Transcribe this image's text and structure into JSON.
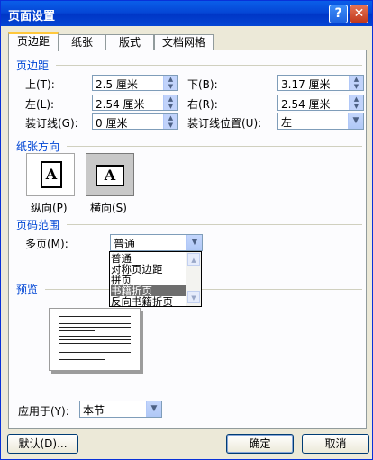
{
  "window": {
    "title": "页面设置",
    "help_glyph": "?",
    "close_glyph": "✕"
  },
  "tabs": [
    "页边距",
    "纸张",
    "版式",
    "文档网格"
  ],
  "margins": {
    "group_title": "页边距",
    "top_label": "上(T):",
    "top_value": "2.5 厘米",
    "bottom_label": "下(B):",
    "bottom_value": "3.17 厘米",
    "left_label": "左(L):",
    "left_value": "2.54 厘米",
    "right_label": "右(R):",
    "right_value": "2.54 厘米",
    "gutter_label": "装订线(G):",
    "gutter_value": "0 厘米",
    "gutter_pos_label": "装订线位置(U):",
    "gutter_pos_value": "左"
  },
  "orientation": {
    "group_title": "纸张方向",
    "icon_letter": "A",
    "portrait_label": "纵向(P)",
    "landscape_label": "横向(S)",
    "selected": "landscape"
  },
  "pages": {
    "group_title": "页码范围",
    "multiple_label": "多页(M):",
    "multiple_value": "普通",
    "options": [
      "普通",
      "对称页边距",
      "拼页",
      "书籍折页",
      "反向书籍折页"
    ],
    "highlighted_index": 3
  },
  "preview": {
    "group_title": "预览"
  },
  "apply": {
    "label": "应用于(Y):",
    "value": "本节"
  },
  "buttons": {
    "default": "默认(D)...",
    "ok": "确定",
    "cancel": "取消"
  },
  "colors": {
    "title_bar": "#0547d6",
    "group_title": "#0046d5",
    "tab_highlight": "#ffc83c"
  }
}
